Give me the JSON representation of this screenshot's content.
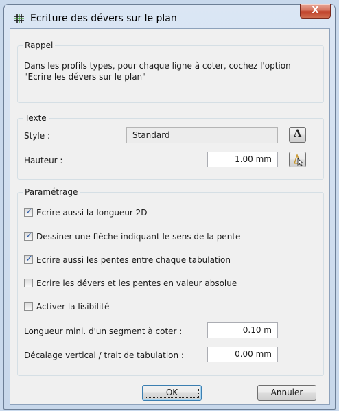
{
  "window": {
    "title": "Ecriture des dévers sur le plan",
    "close_label": "X",
    "icon": "grid-icon"
  },
  "rappel": {
    "group_title": "Rappel",
    "text": "Dans les profils types, pour chaque ligne à coter, cochez l'option \"Ecrire les dévers sur le plan\""
  },
  "texte": {
    "group_title": "Texte",
    "style_label": "Style :",
    "style_value": "Standard",
    "font_button_label": "A",
    "hauteur_label": "Hauteur :",
    "hauteur_value": "1.00 mm",
    "pick_button_icon": "pick-cursor-icon"
  },
  "parametrage": {
    "group_title": "Paramétrage",
    "options": [
      {
        "label": "Ecrire aussi la longueur 2D",
        "checked": true
      },
      {
        "label": "Dessiner une flèche indiquant le sens de la pente",
        "checked": true
      },
      {
        "label": "Ecrire aussi les pentes entre chaque tabulation",
        "checked": true
      },
      {
        "label": "Ecrire les dévers et les pentes en valeur absolue",
        "checked": false
      },
      {
        "label": "Activer la lisibilité",
        "checked": false
      }
    ],
    "longueur_label": "Longueur mini. d'un segment à coter :",
    "longueur_value": "0.10 m",
    "decalage_label": "Décalage vertical / trait de tabulation :",
    "decalage_value": "0.00 mm"
  },
  "buttons": {
    "ok": "OK",
    "cancel": "Annuler"
  },
  "colors": {
    "check_mark": "#2a5aa8",
    "close_button": "#c0412a"
  }
}
